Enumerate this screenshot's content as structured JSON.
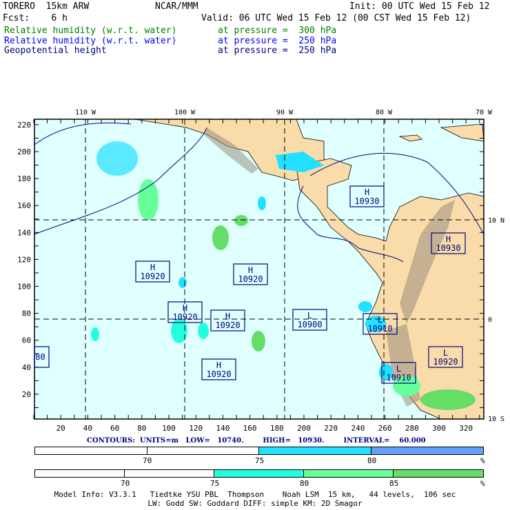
{
  "header": {
    "model": "TORERO  15km ARW",
    "org": "NCAR/MMM",
    "init": "Init: 00 UTC Wed 15 Feb 12",
    "fcst": "Fcst:    6 h",
    "valid": "Valid: 06 UTC Wed 15 Feb 12 (00 CST Wed 15 Feb 12)",
    "fields": [
      {
        "name": "Relative humidity (w.r.t. water)",
        "level": "at pressure =  300 hPa",
        "color": "#008000"
      },
      {
        "name": "Relative humidity (w.r.t. water)",
        "level": "at pressure =  250 hPa",
        "color": "#0000ff"
      },
      {
        "name": "Geopotential height",
        "level": "at pressure =  250 hPa",
        "color": "#000080"
      }
    ]
  },
  "map": {
    "lon_labels": [
      "110 W",
      "100 W",
      "90 W",
      "80 W",
      "70 W"
    ],
    "lat_labels": [
      "10 N",
      "0",
      "10 S"
    ],
    "y_ticks": [
      "20",
      "40",
      "60",
      "80",
      "100",
      "120",
      "140",
      "160",
      "180",
      "200",
      "220"
    ],
    "x_ticks": [
      "20",
      "40",
      "60",
      "80",
      "100",
      "120",
      "140",
      "160",
      "180",
      "200",
      "220",
      "240",
      "260",
      "280",
      "300",
      "320"
    ],
    "centers": [
      {
        "type": "H",
        "value": "10930"
      },
      {
        "type": "H",
        "value": "10930"
      },
      {
        "type": "H",
        "value": "10920"
      },
      {
        "type": "H",
        "value": "10920"
      },
      {
        "type": "H",
        "value": "10920"
      },
      {
        "type": "H",
        "value": "10920"
      },
      {
        "type": "L",
        "value": "10900"
      },
      {
        "type": "L",
        "value": "10910"
      },
      {
        "type": "L",
        "value": "10920"
      },
      {
        "type": "L",
        "value": "10910"
      },
      {
        "type": "H",
        "value": "10920"
      },
      {
        "type": "",
        "value": "80"
      }
    ],
    "colors": {
      "ocean": "#e0ffff",
      "land": "#fadcaa",
      "rh300": "#66dd66",
      "rh250": "#22e0ff"
    }
  },
  "contours": "CONTOURS:  UNITS=m   LOW=   10740.        HIGH=   10930.        INTERVAL=    60.000",
  "colorbar1": {
    "labels": [
      "70",
      "75",
      "80",
      "%"
    ],
    "colors": [
      "#ffffff",
      "#ffffff",
      "#22e0ff",
      "#66a0ff"
    ]
  },
  "colorbar2": {
    "labels": [
      "70",
      "75",
      "80",
      "85",
      "%"
    ],
    "colors": [
      "#ffffff",
      "#ffffff",
      "#22ffdd",
      "#66ff99",
      "#66dd66"
    ]
  },
  "model_info": {
    "line1": "Model Info: V3.3.1   Tiedtke YSU PBL  Thompson    Noah LSM  15 km,   44 levels,  106 sec",
    "line2": "LW: Godd SW: Goddard DIFF: simple KM: 2D Smagor"
  }
}
